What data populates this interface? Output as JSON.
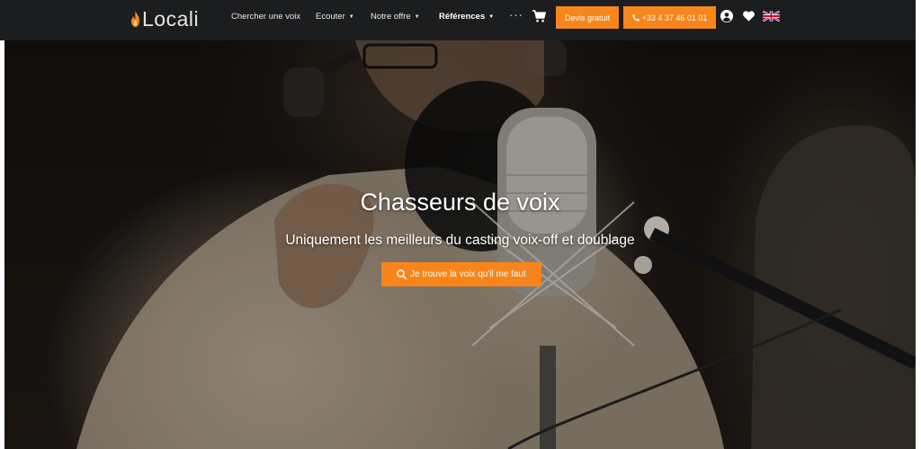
{
  "brand": {
    "logo_text": "Locali",
    "accent_color": "#f7851a",
    "navbar_color": "#1b1d1f"
  },
  "nav": {
    "items": [
      {
        "label": "Chercher une voix",
        "has_caret": false
      },
      {
        "label": "Ecouter",
        "has_caret": true
      },
      {
        "label": "Notre offre",
        "has_caret": true
      },
      {
        "label": "Références",
        "has_caret": true
      }
    ],
    "more_label": "···",
    "cart_icon": "cart-icon",
    "quote_button": "Devis gratuit",
    "phone_button": "+33 4 37 46 01 01",
    "account_icon": "user-icon",
    "favorites_icon": "heart-icon",
    "language_icon": "uk-flag-icon"
  },
  "hero": {
    "title": "Chasseurs de voix",
    "subtitle": "Uniquement les meilleurs du casting voix-off et doublage",
    "cta_label": "Je trouve la voix qu'il me faut",
    "cta_icon": "search-icon"
  }
}
